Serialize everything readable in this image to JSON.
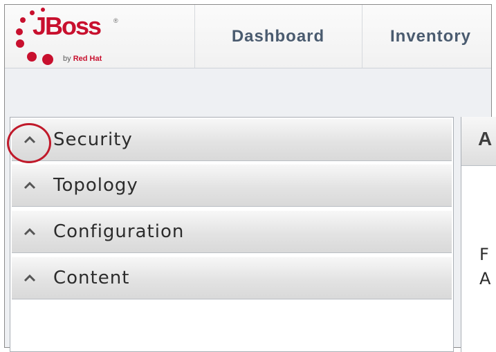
{
  "logo": {
    "brand": "JBoss",
    "registered": "®",
    "tagline_prefix": "by",
    "tagline_company": "Red Hat"
  },
  "nav": {
    "tabs": [
      {
        "label": "Dashboard"
      },
      {
        "label": "Inventory"
      }
    ]
  },
  "sidebar": {
    "sections": [
      {
        "label": "Security",
        "icon": "chevron-up-icon"
      },
      {
        "label": "Topology",
        "icon": "chevron-up-icon"
      },
      {
        "label": "Configuration",
        "icon": "chevron-up-icon"
      },
      {
        "label": "Content",
        "icon": "chevron-up-icon"
      }
    ]
  },
  "right_panel": {
    "header_fragment": "A",
    "line1_fragment": "F",
    "line2_fragment": "A"
  },
  "colors": {
    "brand_red": "#c8102e",
    "nav_text": "#4a5b6f",
    "highlight_ring": "#c0192a"
  }
}
